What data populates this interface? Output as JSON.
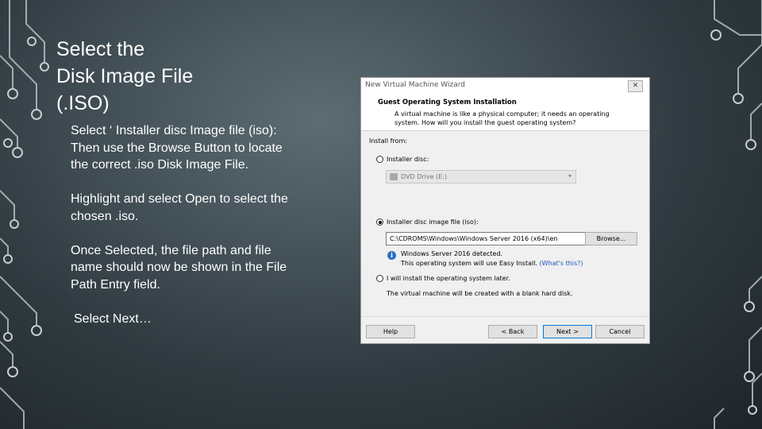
{
  "slide": {
    "title_lines": [
      "Select the",
      "Disk Image File",
      "(.ISO)"
    ],
    "paragraphs": [
      [
        "Select ‘ Installer disc Image file (iso):",
        "Then use the Browse Button to locate",
        "the correct .iso Disk Image File."
      ],
      [
        "Highlight and select Open to select the",
        "chosen .iso."
      ],
      [
        "Once Selected, the file path and file",
        "name should now be shown in the File",
        "Path Entry field."
      ],
      [
        "Select Next…"
      ]
    ]
  },
  "dialog": {
    "title": "New Virtual Machine Wizard",
    "close_icon": "✕",
    "header_title": "Guest Operating System Installation",
    "header_desc_1": "A virtual machine is like a physical computer; it needs an operating",
    "header_desc_2": "system. How will you install the guest operating system?",
    "install_from": "Install from:",
    "option_disc": "Installer disc:",
    "disc_value": "DVD Drive (E:)",
    "option_iso": "Installer disc image file (iso):",
    "iso_path": "C:\\CDROMS\\Windows\\Windows Server 2016 (x64)\\en",
    "browse": "Browse...",
    "detected": "Windows Server 2016 detected.",
    "easy_install": "This operating system will use Easy Install.",
    "whats_this": "(What's this?)",
    "option_later": "I will install the operating system later.",
    "later_desc": "The virtual machine will be created with a blank hard disk.",
    "selected_option": "option_iso",
    "buttons": {
      "help": "Help",
      "back": "< Back",
      "next": "Next >",
      "cancel": "Cancel"
    }
  },
  "colors": {
    "link": "#1a56c4",
    "circuit": "#b9c3c7"
  },
  "icons": {
    "info": "info-icon",
    "disc": "dvd-drive-icon",
    "dropdown": "chevron-down-icon",
    "close": "close-icon"
  }
}
